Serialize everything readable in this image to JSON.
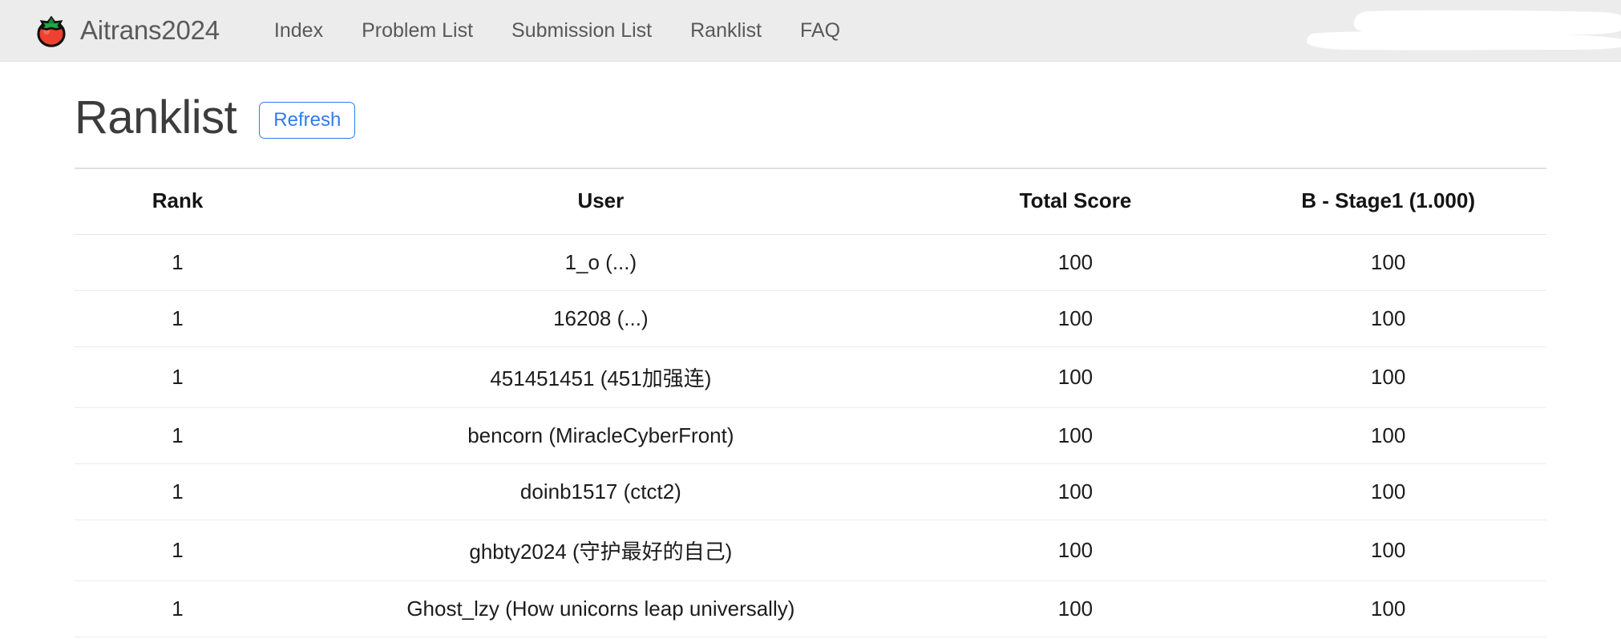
{
  "navbar": {
    "brand": {
      "logo_icon": "tomato-icon",
      "name": "Aitrans2024"
    },
    "links": [
      {
        "label": "Index"
      },
      {
        "label": "Problem List"
      },
      {
        "label": "Submission List"
      },
      {
        "label": "Ranklist"
      },
      {
        "label": "FAQ"
      }
    ],
    "background_color": "#ececec",
    "redaction": {
      "type": "white-brush-stroke",
      "color": "#ffffff"
    }
  },
  "page": {
    "title": "Ranklist",
    "refresh_label": "Refresh",
    "accent_color": "#2f7ced",
    "score_color": "#2eab4f"
  },
  "table": {
    "columns": [
      {
        "key": "rank",
        "label": "Rank"
      },
      {
        "key": "user",
        "label": "User"
      },
      {
        "key": "total",
        "label": "Total Score"
      },
      {
        "key": "prob",
        "label": "B - Stage1 (1.000)"
      }
    ],
    "rows": [
      {
        "rank": "1",
        "user": "1_o (...)",
        "total": "100",
        "prob": "100"
      },
      {
        "rank": "1",
        "user": "16208 (...)",
        "total": "100",
        "prob": "100"
      },
      {
        "rank": "1",
        "user": "451451451 (451加强连)",
        "total": "100",
        "prob": "100"
      },
      {
        "rank": "1",
        "user": "bencorn (MiracleCyberFront)",
        "total": "100",
        "prob": "100"
      },
      {
        "rank": "1",
        "user": "doinb1517 (ctct2)",
        "total": "100",
        "prob": "100"
      },
      {
        "rank": "1",
        "user": "ghbty2024 (守护最好的自己)",
        "total": "100",
        "prob": "100"
      },
      {
        "rank": "1",
        "user": "Ghost_lzy (How unicorns leap universally)",
        "total": "100",
        "prob": "100"
      }
    ]
  }
}
